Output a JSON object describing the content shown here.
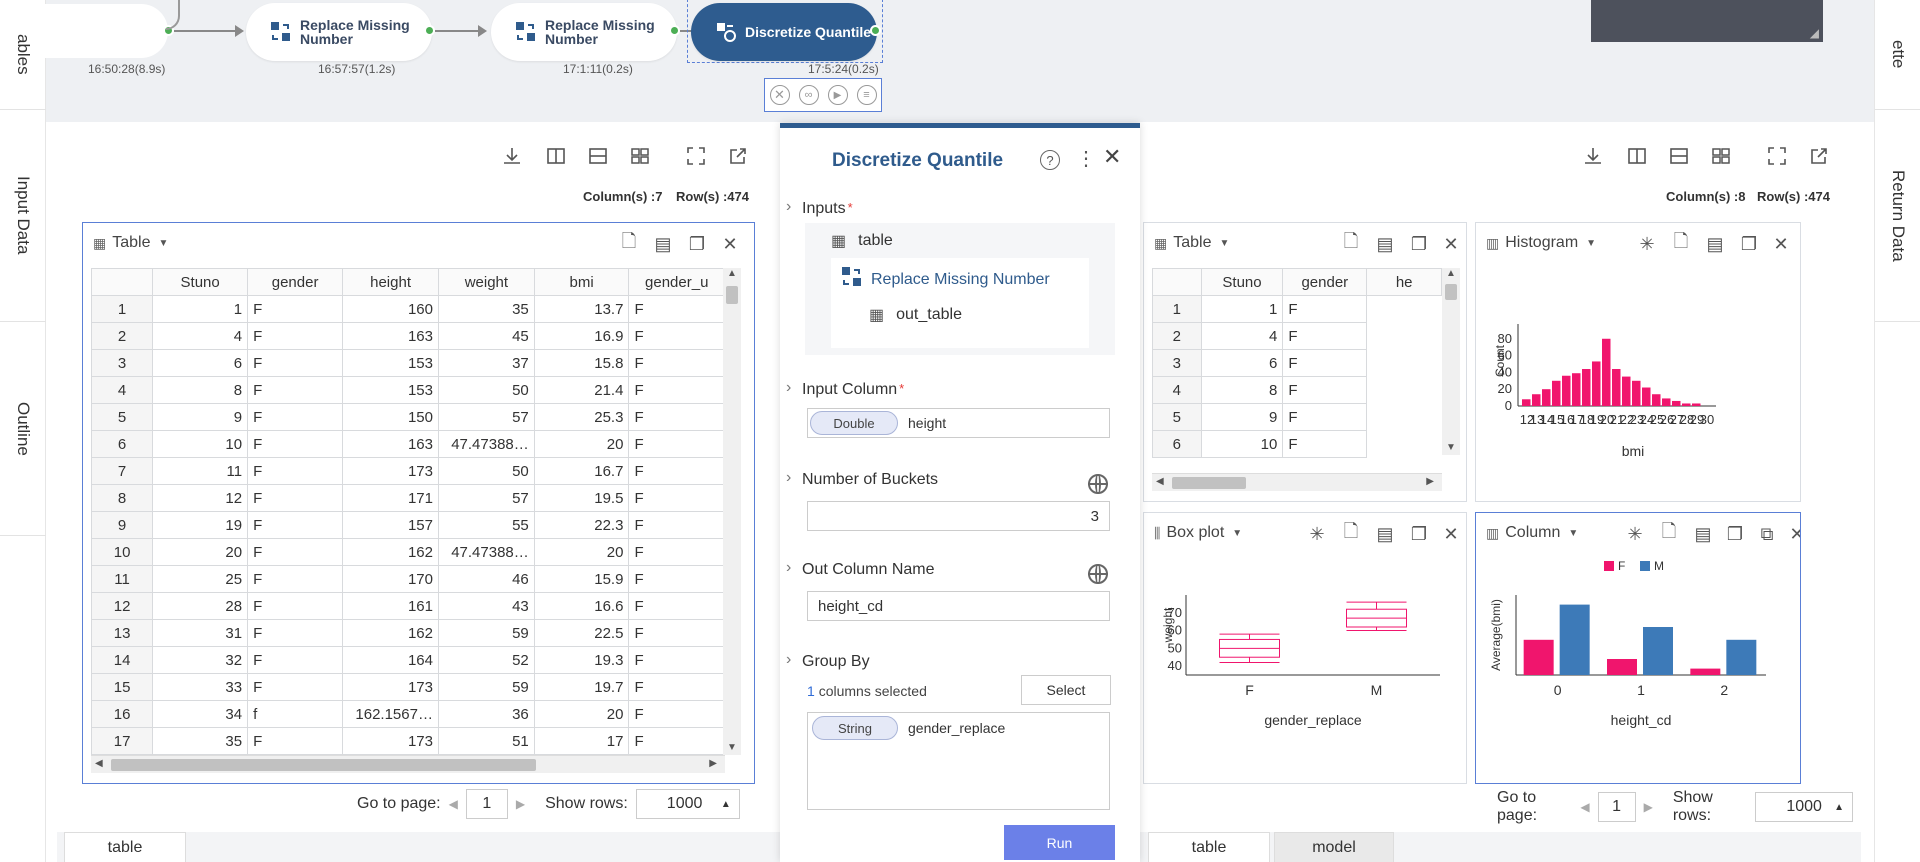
{
  "side_tabs_left": [
    "ables",
    "Input Data",
    "Outline"
  ],
  "side_tabs_right": [
    "ette",
    "Return Data"
  ],
  "flow": {
    "nodes": [
      {
        "label": "Replace Missing Number",
        "time": "16:57:57(1.2s)",
        "icon": "replace-missing-icon"
      },
      {
        "label": "Replace Missing Number",
        "time": "17:1:11(0.2s)",
        "icon": "replace-missing-icon"
      },
      {
        "label": "Discretize Quantile",
        "time": "17:5:24(0.2s)",
        "icon": "discretize-icon"
      }
    ],
    "first_time": "16:50:28(8.9s)",
    "node_actions": [
      "stop-icon",
      "link-icon",
      "play-icon",
      "clipboard-icon"
    ]
  },
  "left_panel": {
    "columns_count": "Column(s) :7",
    "rows_count": "Row(s) :474",
    "card_title": "Table",
    "headers": [
      "Stuno",
      "gender",
      "height",
      "weight",
      "bmi",
      "gender_u"
    ],
    "rows": [
      [
        "1",
        "1",
        "F",
        "160",
        "35",
        "13.7",
        "F"
      ],
      [
        "2",
        "4",
        "F",
        "163",
        "45",
        "16.9",
        "F"
      ],
      [
        "3",
        "6",
        "F",
        "153",
        "37",
        "15.8",
        "F"
      ],
      [
        "4",
        "8",
        "F",
        "153",
        "50",
        "21.4",
        "F"
      ],
      [
        "5",
        "9",
        "F",
        "150",
        "57",
        "25.3",
        "F"
      ],
      [
        "6",
        "10",
        "F",
        "163",
        "47.47388…",
        "20",
        "F"
      ],
      [
        "7",
        "11",
        "F",
        "173",
        "50",
        "16.7",
        "F"
      ],
      [
        "8",
        "12",
        "F",
        "171",
        "57",
        "19.5",
        "F"
      ],
      [
        "9",
        "19",
        "F",
        "157",
        "55",
        "22.3",
        "F"
      ],
      [
        "10",
        "20",
        "F",
        "162",
        "47.47388…",
        "20",
        "F"
      ],
      [
        "11",
        "25",
        "F",
        "170",
        "46",
        "15.9",
        "F"
      ],
      [
        "12",
        "28",
        "F",
        "161",
        "43",
        "16.6",
        "F"
      ],
      [
        "13",
        "31",
        "F",
        "162",
        "59",
        "22.5",
        "F"
      ],
      [
        "14",
        "32",
        "F",
        "164",
        "52",
        "19.3",
        "F"
      ],
      [
        "15",
        "33",
        "F",
        "173",
        "59",
        "19.7",
        "F"
      ],
      [
        "16",
        "34",
        "f",
        "162.1567…",
        "36",
        "20",
        "F"
      ],
      [
        "17",
        "35",
        "F",
        "173",
        "51",
        "17",
        "F"
      ]
    ],
    "goto_label": "Go to page:",
    "page": "1",
    "show_rows_label": "Show rows:",
    "show_rows": "1000",
    "tab": "table"
  },
  "dialog": {
    "title": "Discretize Quantile",
    "inputs_label": "Inputs",
    "input_root": "table",
    "input_node": "Replace Missing Number",
    "input_leaf": "out_table",
    "input_column_label": "Input Column",
    "input_column_type": "Double",
    "input_column_value": "height",
    "buckets_label": "Number of Buckets",
    "buckets_value": "3",
    "out_col_label": "Out Column Name",
    "out_col_value": "height_cd",
    "group_by_label": "Group By",
    "group_by_count": "1",
    "group_by_selected": "columns selected",
    "select_button": "Select",
    "group_type": "String",
    "group_value": "gender_replace",
    "run_button": "Run"
  },
  "right_panel": {
    "columns_count": "Column(s) :8",
    "rows_count": "Row(s) :474",
    "table_title": "Table",
    "headers": [
      "Stuno",
      "gender",
      "he"
    ],
    "rows": [
      [
        "1",
        "1",
        "F"
      ],
      [
        "2",
        "4",
        "F"
      ],
      [
        "3",
        "6",
        "F"
      ],
      [
        "4",
        "8",
        "F"
      ],
      [
        "5",
        "9",
        "F"
      ],
      [
        "6",
        "10",
        "F"
      ]
    ],
    "histogram_title": "Histogram",
    "boxplot_title": "Box plot",
    "column_title": "Column",
    "goto_label": "Go to page:",
    "page": "1",
    "show_rows_label": "Show rows:",
    "show_rows": "1000",
    "tabs": [
      "table",
      "model"
    ]
  },
  "chart_data": [
    {
      "type": "bar",
      "title": "Histogram",
      "xlabel": "bmi",
      "ylabel": "Count",
      "ylim": [
        0,
        80
      ],
      "yticks": [
        "80",
        "60",
        "40",
        "20",
        "0"
      ],
      "categories": [
        "12",
        "13",
        "14",
        "15",
        "16",
        "17",
        "18",
        "19",
        "20",
        "21",
        "22",
        "23",
        "24",
        "25",
        "26",
        "27",
        "28",
        "29",
        "30"
      ],
      "values": [
        8,
        14,
        20,
        30,
        36,
        39,
        44,
        53,
        80,
        44,
        35,
        30,
        22,
        14,
        9,
        6,
        3,
        3,
        0
      ],
      "color": "#f0156d"
    },
    {
      "type": "box",
      "title": "Box plot",
      "xlabel": "gender_replace",
      "ylabel": "weight",
      "categories": [
        "F",
        "M"
      ],
      "yticks": [
        "70",
        "60",
        "50",
        "40"
      ],
      "boxes": [
        {
          "min": 42,
          "q1": 45,
          "median": 50,
          "q3": 55,
          "max": 58
        },
        {
          "min": 60,
          "q1": 62,
          "median": 67,
          "q3": 72,
          "max": 76
        }
      ],
      "color": "#f0156d"
    },
    {
      "type": "bar",
      "title": "Column",
      "xlabel": "height_cd",
      "ylabel": "Average(bmi)",
      "categories": [
        "0",
        "1",
        "2"
      ],
      "series": [
        {
          "name": "F",
          "values": [
            1.1,
            0.5,
            0.2
          ],
          "color": "#f0156d"
        },
        {
          "name": "M",
          "values": [
            2.2,
            1.5,
            1.1
          ],
          "color": "#3d7ab8"
        }
      ],
      "ylim": [
        0,
        2.5
      ],
      "legend": "top"
    }
  ]
}
